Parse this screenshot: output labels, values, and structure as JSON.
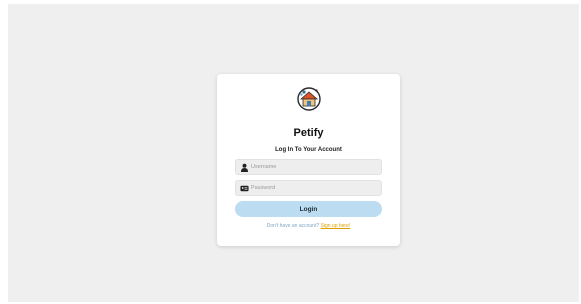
{
  "app": {
    "brand": "Petify",
    "subtitle": "Log In To Your Account"
  },
  "form": {
    "username_placeholder": "Username",
    "username_value": "",
    "password_placeholder": "Password",
    "password_value": "",
    "login_label": "Login"
  },
  "signup": {
    "prompt": "Don't have an account?",
    "link_label": "Sign up here!"
  },
  "icons": {
    "logo": "pet-house-logo-icon",
    "username": "user-icon",
    "password": "id-card-icon"
  },
  "colors": {
    "background": "#efefef",
    "card": "#ffffff",
    "login_button": "#bcdcf1",
    "link": "#e0a000",
    "signup_text": "#7fa6c4"
  }
}
